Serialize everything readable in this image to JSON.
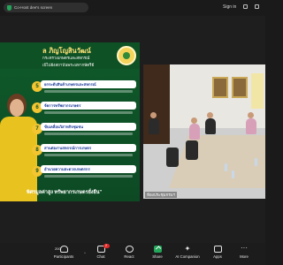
{
  "topbar": {
    "screen_label": "Co-Host dee's screen",
    "signin_label": "Sign in"
  },
  "slide": {
    "title": "ล ภิญโญสินวัฒน์",
    "subtitle1": "กระทรวงเกษตรและสหกรณ์",
    "subtitle2": "เป้ไปยังสถาบันพระมหากษัตริย์",
    "items": [
      {
        "num": "5",
        "text": "ยกระดับสินค้าเกษตรและสหกรณ์"
      },
      {
        "num": "6",
        "text": "จัดการทรัพยากรเกษตร"
      },
      {
        "num": "7",
        "text": "ขับเคลื่อนวิสาหกิจชุมชน"
      },
      {
        "num": "8",
        "text": "สานต่องานสหกรณ์การเกษตร"
      },
      {
        "num": "9",
        "text": "อำนวยความสะดวกเกษตรกร"
      }
    ],
    "slogan": "พิศรมูลค่าสูง ทรัพยากรเกษตรยั่งยืน\""
  },
  "room": {
    "caption": "ห้องประชุมกรมฯ"
  },
  "toolbar": {
    "participants_label": "Participants",
    "participants_count": "200",
    "chat_label": "Chat",
    "chat_badge": "2",
    "react_label": "React",
    "share_label": "Share",
    "ai_label": "AI Companion",
    "apps_label": "Apps",
    "more_label": "More"
  }
}
